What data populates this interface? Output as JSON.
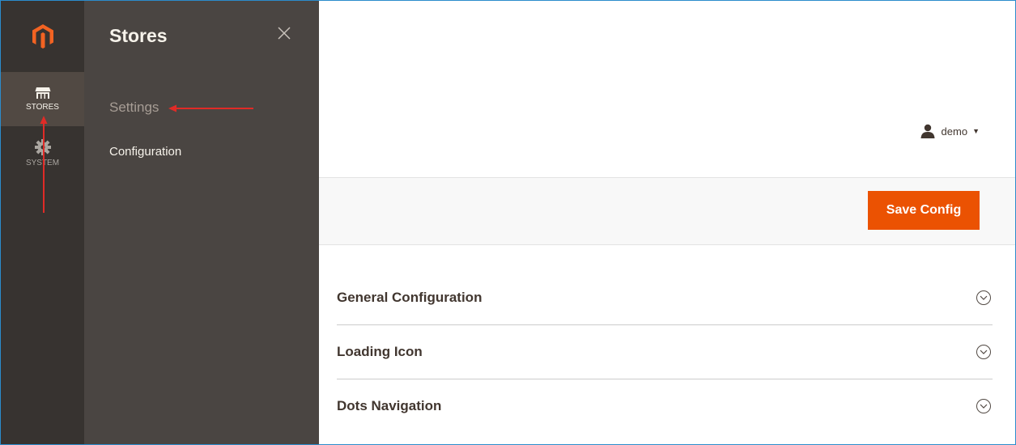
{
  "nav": {
    "items": [
      {
        "label": "STORES",
        "icon": "store-icon",
        "active": true
      },
      {
        "label": "SYSTEM",
        "icon": "gear-icon",
        "active": false
      }
    ]
  },
  "panel": {
    "title": "Stores",
    "section": "Settings",
    "link": "Configuration"
  },
  "header": {
    "user": "demo"
  },
  "actions": {
    "save_label": "Save Config"
  },
  "sections": [
    {
      "title": "General Configuration"
    },
    {
      "title": "Loading Icon"
    },
    {
      "title": "Dots Navigation"
    }
  ],
  "colors": {
    "accent": "#eb5202",
    "nav_bg": "#373330",
    "panel_bg": "#4a4542",
    "annotation": "#e02b27"
  }
}
